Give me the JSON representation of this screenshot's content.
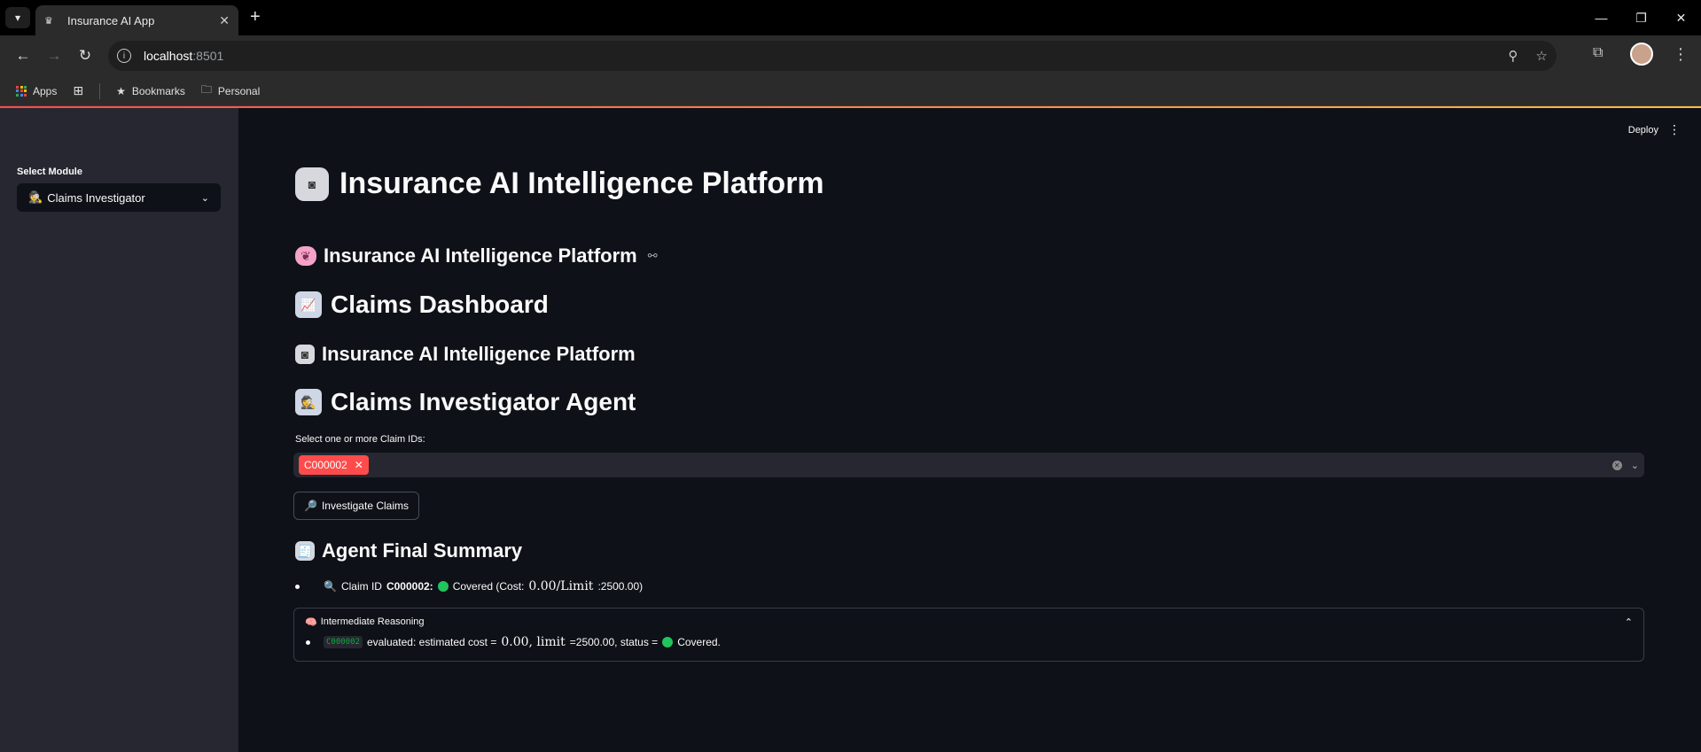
{
  "browser": {
    "tab_title": "Insurance AI App",
    "url_host": "localhost",
    "url_port": ":8501",
    "bookmarks": [
      "Apps",
      "Bookmarks",
      "Personal"
    ]
  },
  "app": {
    "deploy_label": "Deploy",
    "sidebar": {
      "label": "Select Module",
      "selected_module": "Claims Investigator"
    },
    "headings": {
      "h1": "Insurance AI Intelligence Platform",
      "h3_first": "Insurance AI Intelligence Platform",
      "h2_dashboard": "Claims Dashboard",
      "h3_second": "Insurance AI Intelligence Platform",
      "h2_agent": "Claims Investigator Agent",
      "h3_summary": "Agent Final Summary"
    },
    "claim_select": {
      "label": "Select one or more Claim IDs:",
      "selected": [
        "C000002"
      ]
    },
    "investigate_button": "Investigate Claims",
    "summary": {
      "prefix": "Claim ID",
      "claim_id": "C000002:",
      "status_text": "Covered (Cost:",
      "math": "0.00/Limit",
      "tail": ":2500.00)"
    },
    "reasoning": {
      "title": "Intermediate Reasoning",
      "code": "C000002",
      "text_a": "evaluated: estimated cost =",
      "math": "0.00, limit",
      "text_b": "=2500.00, status =",
      "text_c": "Covered."
    }
  }
}
